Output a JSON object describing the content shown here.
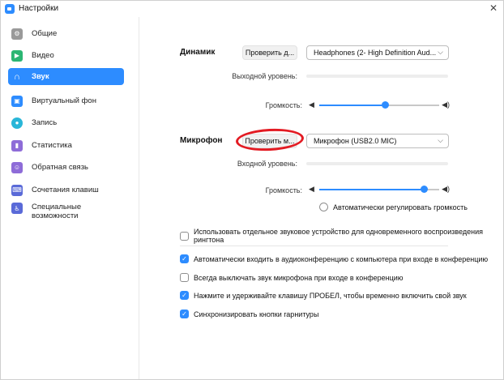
{
  "window": {
    "title": "Настройки"
  },
  "colors": {
    "accent": "#2d8cff",
    "annotation": "#e31b23"
  },
  "sidebar": {
    "items": [
      {
        "label": "Общие",
        "icon": "gear-icon",
        "color": "#9a9a9a"
      },
      {
        "label": "Видео",
        "icon": "video-icon",
        "color": "#2bb673"
      },
      {
        "label": "Звук",
        "icon": "headphones-icon",
        "color": "#2d8cff",
        "active": true
      },
      {
        "label": "Виртуальный фон",
        "icon": "virtual-background-icon",
        "color": "#2d8cff"
      },
      {
        "label": "Запись",
        "icon": "record-icon",
        "color": "#29b6d8"
      },
      {
        "label": "Статистика",
        "icon": "statistics-icon",
        "color": "#8e6cd8"
      },
      {
        "label": "Обратная связь",
        "icon": "feedback-icon",
        "color": "#8e6cd8"
      },
      {
        "label": "Сочетания клавиш",
        "icon": "keyboard-icon",
        "color": "#5a6ad8"
      },
      {
        "label": "Специальные возможности",
        "icon": "accessibility-icon",
        "color": "#5a6ad8"
      }
    ]
  },
  "speaker": {
    "label": "Динамик",
    "test_button": "Проверить д...",
    "device": "Headphones (2- High Definition Aud...",
    "output_level_label": "Выходной уровень:",
    "volume_label": "Громкость:",
    "volume": 0.55
  },
  "microphone": {
    "label": "Микрофон",
    "test_button": "Проверить м...",
    "device": "Микрофон (USB2.0 MIC)",
    "input_level_label": "Входной уровень:",
    "volume_label": "Громкость:",
    "volume": 0.87,
    "auto_adjust_label": "Автоматически регулировать громкость",
    "auto_adjust": false
  },
  "options": [
    {
      "label": "Использовать отдельное звуковое устройство для одновременного воспроизведения рингтона",
      "checked": false
    },
    {
      "label": "Автоматически входить в аудиоконференцию с компьютера при входе в конференцию",
      "checked": true
    },
    {
      "label": "Всегда выключать звук микрофона при входе в конференцию",
      "checked": false
    },
    {
      "label": "Нажмите и удерживайте клавишу ПРОБЕЛ, чтобы временно включить свой звук",
      "checked": true
    },
    {
      "label": "Синхронизировать кнопки гарнитуры",
      "checked": true
    }
  ]
}
